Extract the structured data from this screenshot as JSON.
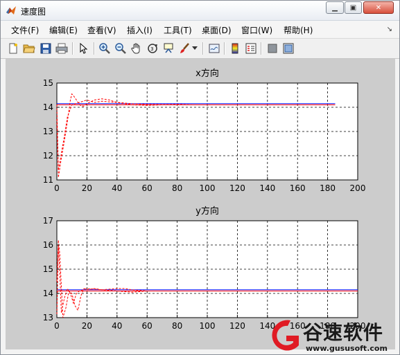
{
  "window": {
    "title": "速度图"
  },
  "menu": {
    "items": [
      {
        "label": "文件(F)"
      },
      {
        "label": "编辑(E)"
      },
      {
        "label": "查看(V)"
      },
      {
        "label": "插入(I)"
      },
      {
        "label": "工具(T)"
      },
      {
        "label": "桌面(D)"
      },
      {
        "label": "窗口(W)"
      },
      {
        "label": "帮助(H)"
      }
    ]
  },
  "toolbar": {
    "icons": [
      "new-figure-icon",
      "open-icon",
      "save-icon",
      "print-icon",
      "pointer-icon",
      "zoom-in-icon",
      "zoom-out-icon",
      "pan-hand-icon",
      "rotate-3d-icon",
      "data-cursor-icon",
      "brush-icon",
      "brush-dropdown-icon",
      "link-plot-icon",
      "colorbar-icon",
      "legend-icon",
      "hide-plot-tools-icon",
      "show-plot-tools-icon"
    ]
  },
  "chart_data": [
    {
      "type": "line",
      "title": "x方向",
      "xlim": [
        0,
        200
      ],
      "ylim": [
        11,
        15
      ],
      "xticks": [
        "0",
        "20",
        "40",
        "60",
        "80",
        "100",
        "120",
        "140",
        "160",
        "180",
        "200"
      ],
      "yticks": [
        "11",
        "12",
        "13",
        "14",
        "15"
      ],
      "grid": true,
      "series": [
        {
          "color": "#0000ff",
          "style": "solid",
          "x": [
            0,
            185
          ],
          "y": [
            14.15,
            14.15
          ]
        },
        {
          "color": "#ff0000",
          "style": "solid",
          "x": [
            0,
            185
          ],
          "y": [
            14.1,
            14.1
          ]
        },
        {
          "color": "#ff0000",
          "style": "dashed",
          "x": [
            0,
            1,
            3,
            5,
            7,
            9,
            10,
            12,
            14,
            16,
            18,
            20,
            25,
            30,
            35,
            40,
            45,
            50,
            60,
            70,
            80,
            90,
            100,
            120,
            140,
            160,
            180,
            185
          ],
          "y": [
            13.5,
            11.1,
            11.9,
            12.6,
            13.4,
            14.3,
            14.55,
            14.4,
            14.2,
            14.05,
            14.05,
            14.15,
            14.3,
            14.35,
            14.3,
            14.2,
            14.15,
            14.1,
            14.08,
            14.1,
            14.12,
            14.1,
            14.1,
            14.1,
            14.1,
            14.1,
            14.1,
            14.1
          ]
        },
        {
          "color": "#ff0000",
          "style": "dashed",
          "x": [
            0,
            1,
            3,
            5,
            7,
            10,
            15,
            20,
            25,
            30,
            40,
            50,
            60,
            80,
            100,
            120,
            140,
            160,
            180,
            185
          ],
          "y": [
            14.1,
            11.4,
            12.1,
            12.8,
            13.6,
            14.1,
            14.2,
            14.3,
            14.2,
            14.25,
            14.2,
            14.15,
            14.12,
            14.1,
            14.1,
            14.1,
            14.1,
            14.1,
            14.1,
            14.1
          ]
        }
      ]
    },
    {
      "type": "line",
      "title": "y方向",
      "xlim": [
        0,
        200
      ],
      "ylim": [
        13,
        17
      ],
      "xticks": [
        "0",
        "20",
        "40",
        "60",
        "80",
        "100",
        "120",
        "140",
        "160",
        "180",
        "200"
      ],
      "yticks": [
        "13",
        "14",
        "15",
        "16",
        "17"
      ],
      "grid": true,
      "series": [
        {
          "color": "#0000ff",
          "style": "solid",
          "x": [
            0,
            200
          ],
          "y": [
            14.15,
            14.15
          ]
        },
        {
          "color": "#ff0000",
          "style": "solid",
          "x": [
            0,
            200
          ],
          "y": [
            14.1,
            14.1
          ]
        },
        {
          "color": "#ff0000",
          "style": "dashed",
          "x": [
            0,
            1,
            2,
            4,
            6,
            8,
            10,
            12,
            14,
            16,
            18,
            20,
            25,
            30,
            40,
            50,
            60,
            80,
            100,
            120,
            140,
            160,
            180,
            200
          ],
          "y": [
            14.5,
            16.2,
            15.6,
            13.0,
            13.4,
            14.1,
            14.0,
            13.5,
            13.3,
            13.9,
            14.2,
            14.15,
            14.2,
            14.15,
            14.1,
            14.05,
            14.1,
            14.1,
            14.1,
            14.1,
            14.1,
            14.1,
            14.1,
            14.1
          ]
        },
        {
          "color": "#ff0000",
          "style": "dashed",
          "x": [
            0,
            1,
            2,
            3,
            5,
            7,
            9,
            11,
            13,
            15,
            20,
            30,
            40,
            45,
            50,
            60,
            80,
            100,
            200
          ],
          "y": [
            13.0,
            16.0,
            14.8,
            13.2,
            13.8,
            14.2,
            14.0,
            13.6,
            14.0,
            14.1,
            14.2,
            14.15,
            14.2,
            14.2,
            14.15,
            14.1,
            14.1,
            14.1,
            14.1
          ]
        }
      ]
    }
  ],
  "watermark": {
    "text": "谷速软件",
    "url": "www.gususoft.com"
  }
}
